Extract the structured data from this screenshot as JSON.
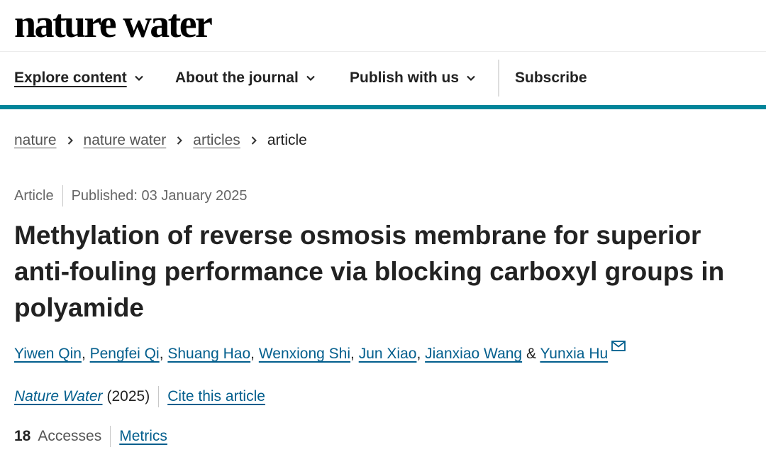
{
  "logo": {
    "text": "nature water"
  },
  "nav": {
    "items": [
      {
        "label": "Explore content",
        "has_dropdown": true,
        "active": true
      },
      {
        "label": "About the journal",
        "has_dropdown": true
      },
      {
        "label": "Publish with us",
        "has_dropdown": true
      },
      {
        "label": "Subscribe",
        "has_dropdown": false
      }
    ],
    "accent_color": "#01859a"
  },
  "breadcrumb": {
    "items": [
      "nature",
      "nature water",
      "articles"
    ],
    "current": "article"
  },
  "article": {
    "type": "Article",
    "published": "Published: 03 January 2025",
    "title": "Methylation of reverse osmosis membrane for superior anti-fouling performance via blocking carboxyl groups in polyamide",
    "authors": [
      "Yiwen Qin",
      "Pengfei Qi",
      "Shuang Hao",
      "Wenxiong Shi",
      "Jun Xiao",
      "Jianxiao Wang",
      "Yunxia Hu"
    ],
    "author_separator": ",",
    "author_last_joiner": "&",
    "corresponding_icon": "envelope-icon",
    "journal": "Nature Water",
    "year": "(2025)",
    "cite_label": "Cite this article",
    "accesses_count": "18",
    "accesses_label": "Accesses",
    "metrics_label": "Metrics",
    "link_color": "#025e8d"
  }
}
